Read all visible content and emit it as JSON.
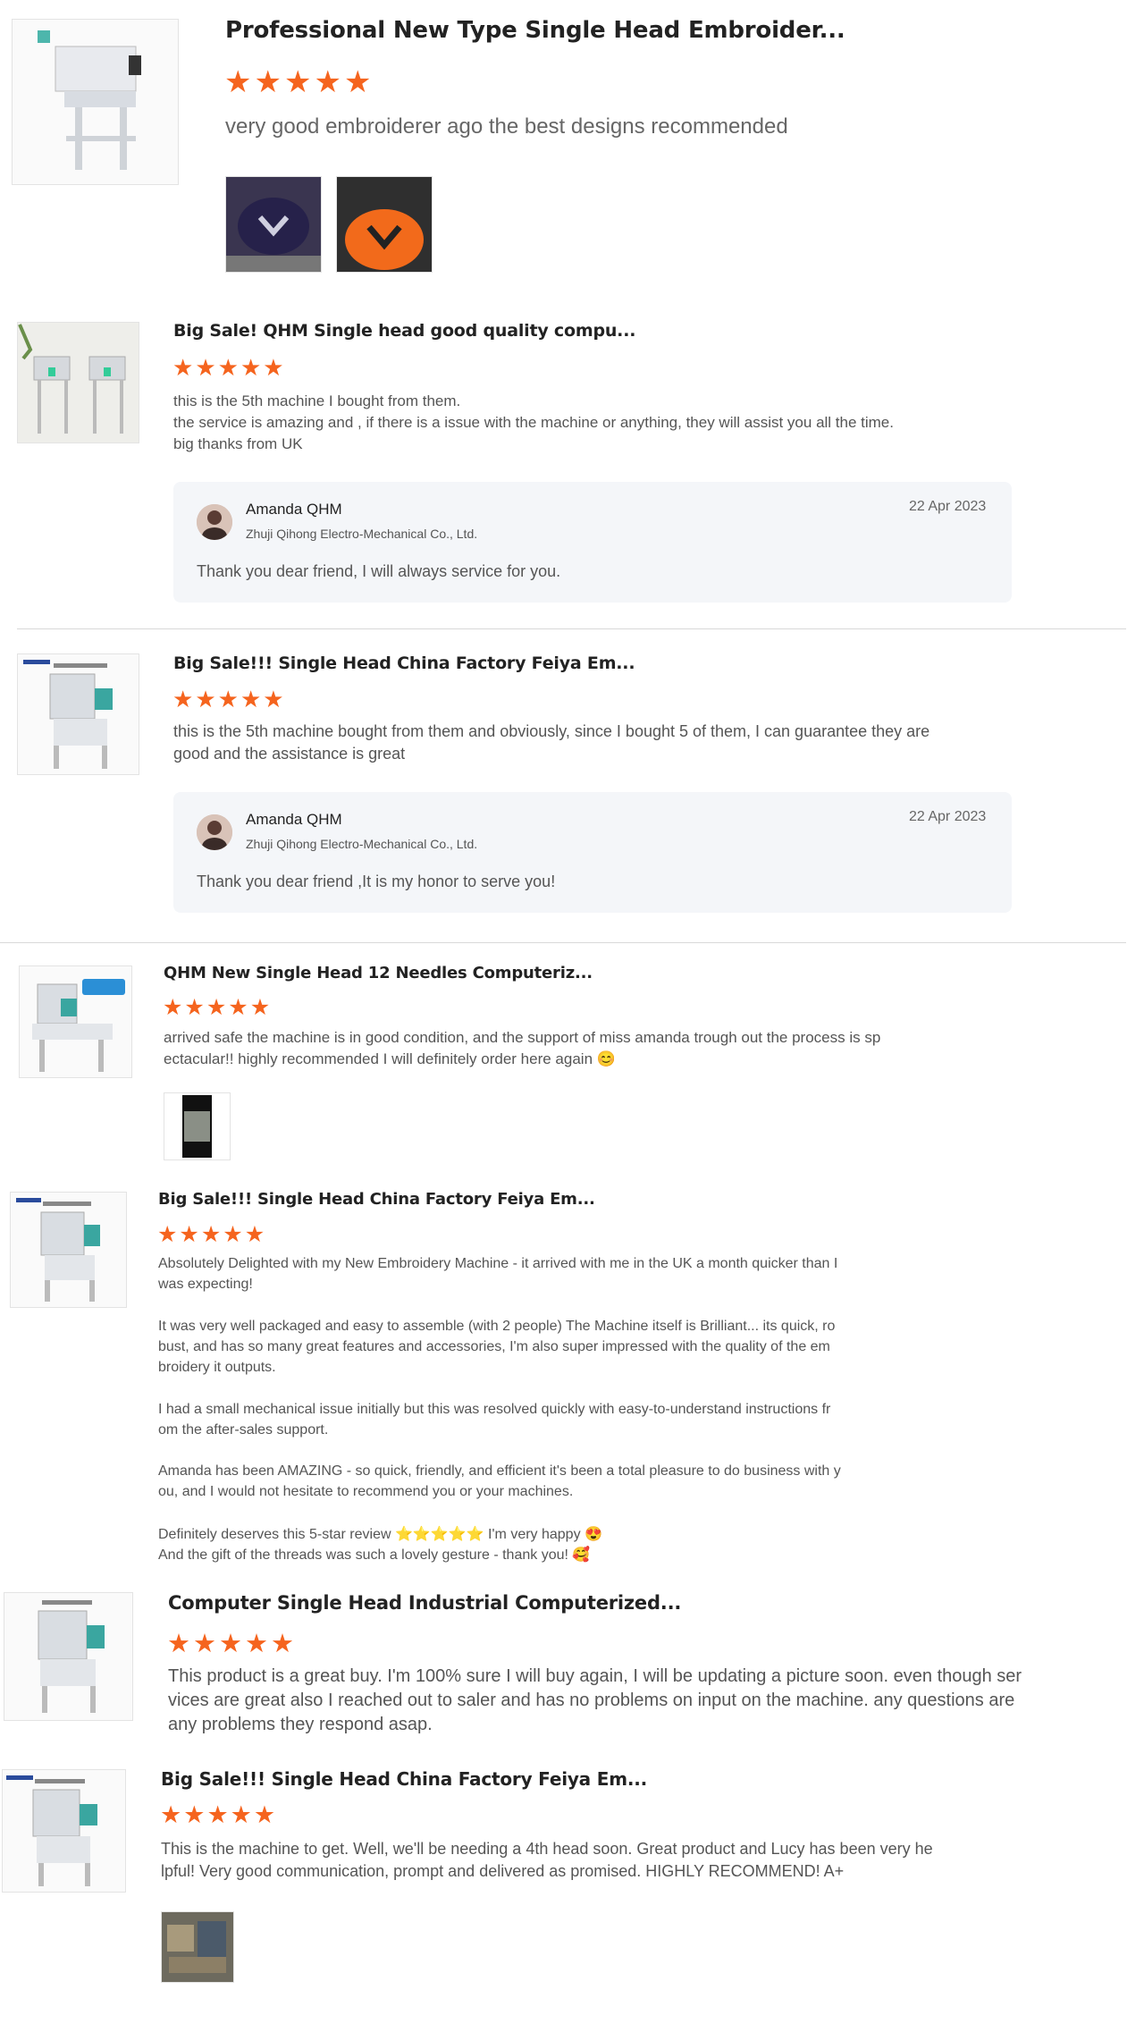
{
  "star_icon": "★",
  "colors": {
    "star": "#f5641e",
    "reply_bg": "#f4f6f9"
  },
  "reviews": [
    {
      "title": "Professional New Type Single Head Embroider...",
      "rating": 5,
      "lines": [
        "very good embroiderer ago the best designs recommended"
      ]
    },
    {
      "title": "Big Sale! QHM Single head good quality compu...",
      "rating": 5,
      "lines": [
        "this is the 5th machine I bought from them.",
        "the service is amazing and , if there is a issue with the machine or anything, they will assist you all the time.",
        "big thanks from UK"
      ],
      "reply": {
        "name": "Amanda QHM",
        "company": "Zhuji Qihong Electro-Mechanical Co., Ltd.",
        "date": "22 Apr 2023",
        "text": "Thank you dear friend, I will always service for you."
      }
    },
    {
      "title": "Big Sale!!! Single Head China Factory Feiya Em...",
      "rating": 5,
      "lines": [
        "this is the 5th machine bought from them and obviously, since I bought 5 of them, I can guarantee they are",
        "good and the assistance is great"
      ],
      "reply": {
        "name": "Amanda QHM",
        "company": "Zhuji Qihong Electro-Mechanical Co., Ltd.",
        "date": "22 Apr 2023",
        "text": "Thank you dear friend ,It is my honor to serve you!"
      }
    },
    {
      "title": "QHM New Single Head 12 Needles Computeriz...",
      "rating": 5,
      "lines": [
        "arrived safe the machine is in good condition, and the support of miss amanda trough out the process is sp",
        "ectacular!! highly recommended I will definitely order here again 😊"
      ]
    },
    {
      "title": "Big Sale!!! Single Head China Factory Feiya Em...",
      "rating": 5,
      "lines": [
        "Absolutely Delighted with my New Embroidery Machine - it arrived with me in the UK a month quicker than I",
        "was expecting!",
        "",
        "It was very well packaged and easy to assemble (with 2 people) The Machine itself is Brilliant... its quick, ro",
        "bust, and has so many great features and accessories, I'm also super impressed with the quality of the em",
        "broidery it outputs.",
        "",
        "I had a small mechanical issue initially but this was resolved quickly with easy-to-understand instructions fr",
        "om the after-sales support.",
        "",
        "Amanda has been AMAZING - so quick, friendly, and efficient it's been a total pleasure to do business with y",
        "ou, and I would not hesitate to recommend you or your machines.",
        "",
        "Definitely deserves this 5-star review ⭐⭐⭐⭐⭐  I'm very happy 😍",
        "And the gift of the threads was such a lovely gesture - thank you! 🥰"
      ]
    },
    {
      "title": "Computer Single Head Industrial Computerized...",
      "rating": 5,
      "lines": [
        "This product is a great buy. I'm 100% sure I will buy again, I will be updating a picture soon. even though ser",
        "vices are great also I reached out to saler and has no problems on input on the machine. any questions are",
        "any problems they respond asap."
      ]
    },
    {
      "title": "Big Sale!!! Single Head China Factory Feiya Em...",
      "rating": 5,
      "lines": [
        "This is the machine to get. Well, we'll be needing a 4th head soon. Great product and Lucy has been very he",
        "lpful! Very good communication, prompt and delivered as promised. HIGHLY RECOMMEND! A+"
      ]
    }
  ]
}
